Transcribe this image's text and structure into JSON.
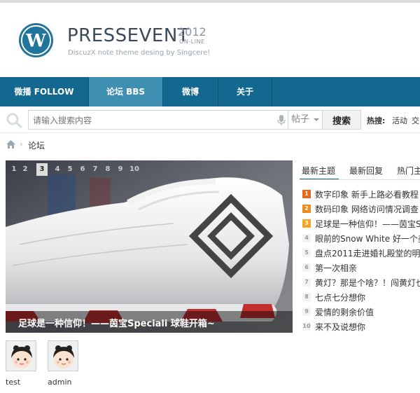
{
  "site": {
    "title": "PRESSEVENT",
    "year": "2012",
    "online": "ON-LINE",
    "tagline": "DiscuzX note theme desing by Singcere!"
  },
  "nav": {
    "items": [
      {
        "label": "微播 FOLLOW"
      },
      {
        "label": "论坛 BBS"
      },
      {
        "label": "微博"
      },
      {
        "label": "关于"
      }
    ]
  },
  "search": {
    "placeholder": "请输入搜索内容",
    "scope": "帖子",
    "button": "搜索",
    "hot_label": "热搜:",
    "hot_links": [
      "活动",
      "交"
    ]
  },
  "breadcrumb": {
    "current": "论坛"
  },
  "slider": {
    "numbers": [
      "1",
      "2",
      "3",
      "4",
      "5",
      "6",
      "7",
      "8",
      "9",
      "10"
    ],
    "active_index": 2,
    "caption": "足球是一种信仰！——茵宝Speciali 球鞋开箱~"
  },
  "panel": {
    "tabs": [
      "最新主题",
      "最新回复",
      "热门主"
    ],
    "threads": [
      {
        "rank": "1",
        "title": "数字印象 新手上路必看教程"
      },
      {
        "rank": "2",
        "title": "数码印象 网络访问情况调查"
      },
      {
        "rank": "3",
        "title": "足球是一种信仰！——茵宝Spe"
      },
      {
        "rank": "4",
        "title": "眼前的Snow White 好一个美人"
      },
      {
        "rank": "5",
        "title": "盘点2011走进婚礼殿堂的明星"
      },
      {
        "rank": "6",
        "title": "第一次相亲"
      },
      {
        "rank": "7",
        "title": "黄灯？那是个啥？！闯黄灯也要"
      },
      {
        "rank": "8",
        "title": "七点七分想你"
      },
      {
        "rank": "9",
        "title": "爱情的剩余价值"
      },
      {
        "rank": "10",
        "title": "来不及说想你"
      }
    ]
  },
  "users": [
    {
      "name": "test"
    },
    {
      "name": "admin"
    }
  ],
  "colors": {
    "nav": "#12688f",
    "nav_active": "#3f8fb2",
    "logo": "#21759b"
  }
}
